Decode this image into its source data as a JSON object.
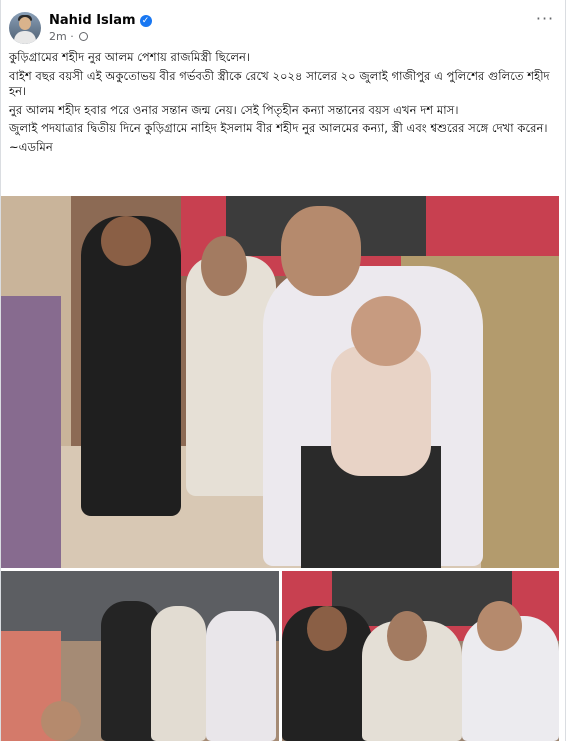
{
  "post": {
    "author": "Nahid Islam",
    "time": "2m",
    "paragraphs": [
      "কুড়িগ্রামের শহীদ নুর আলম পেশায় রাজমিস্ত্রী ছিলেন।",
      "বাইশ বছর বয়সী এই অকুতোভয় বীর গর্ভবতী স্ত্রীকে রেখে ২০২৪ সালের ২০ জুলাই গাজীপুর এ পুলিশের গুলিতে শহীদ হন।",
      "নুর আলম শহীদ হবার পরে ওনার সন্তান জন্ম নেয়। সেই পিতৃহীন কন্যা সন্তানের বয়স এখন দশ মাস।",
      "জুলাই পদযাত্রার দ্বিতীয় দিনে কুড়িগ্রামে নাহিদ ইসলাম বীর শহীদ নুর আলমের কন্যা, স্ত্রী এবং শ্বশুরের সঙ্গে দেখা করেন।",
      "~এডমিন"
    ]
  },
  "icons": {
    "verified": "verified-badge-icon",
    "privacy": "globe-icon",
    "more": "more-options-icon"
  },
  "colors": {
    "brand_blue": "#1877f2",
    "text_primary": "#050505",
    "text_secondary": "#65676b"
  }
}
